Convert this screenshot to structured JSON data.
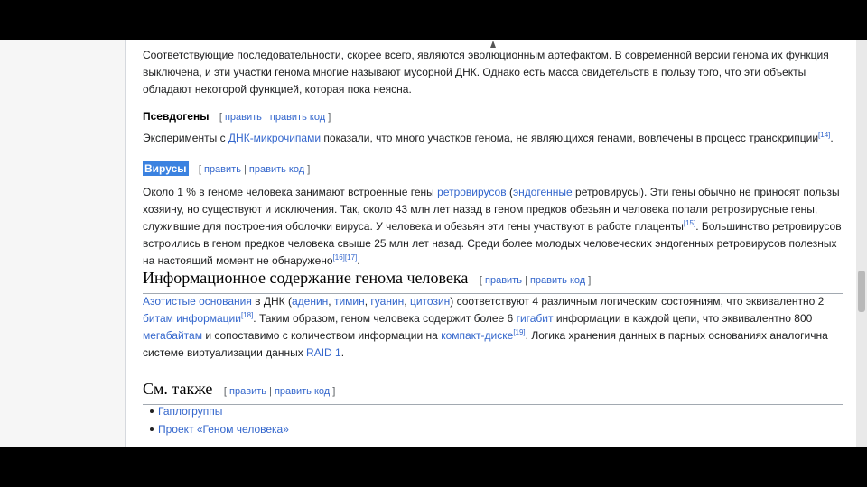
{
  "intro_text": "Соответствующие последовательности, скорее всего, являются эволюционным артефактом. В современной версии генома их функция выключена, и эти участки генома многие называют мусорной ДНК. Однако есть масса свидетельств в пользу того, что эти объекты обладают некоторой функцией, которая пока неясна.",
  "edit": {
    "open": "[",
    "edit": "править",
    "sep": "|",
    "edit_code": "править код",
    "close": "]"
  },
  "pseudogenes": {
    "heading": "Псевдогены",
    "p_before": "Эксперименты с ",
    "link_dna_chips": "ДНК-микрочипами",
    "p_after": " показали, что много участков генома, не являющихся генами, вовлечены в процесс транскрипции",
    "ref": "[14]",
    "end": "."
  },
  "viruses": {
    "heading": "Вирусы",
    "t1": "Около 1 % в геноме человека занимают встроенные гены ",
    "link_retro": "ретровирусов",
    "t2": " (",
    "link_endo": "эндогенные",
    "t3": " ретровирусы). Эти гены обычно не приносят пользы хозяину, но существуют и исключения. Так, около 43 млн лет назад в геном предков обезьян и человека попали ретровирусные гены, служившие для построения оболочки вируса. У человека и обезьян эти гены участвуют в работе плаценты",
    "ref15": "[15]",
    "t4": ". Большинство ретровирусов встроились в геном предков человека свыше 25 млн лет назад. Среди более молодых человеческих эндогенных ретровирусов полезных на настоящий момент не обнаружено",
    "ref16": "[16]",
    "ref17": "[17]",
    "end": "."
  },
  "info": {
    "heading": "Информационное содержание генома человека",
    "link_bases": "Азотистые основания",
    "t1": " в ДНК (",
    "link_adenine": "аденин",
    "c1": ", ",
    "link_thymine": "тимин",
    "c2": ", ",
    "link_guanine": "гуанин",
    "c3": ", ",
    "link_cytosine": "цитозин",
    "t2": ") соответствуют 4 различным логическим состояниям, что эквивалентно 2 ",
    "link_bits": "битам информации",
    "ref18": "[18]",
    "t3": ". Таким образом, геном человека содержит более 6 ",
    "link_gigabit": "гигабит",
    "t4": " информации в каждой цепи, что эквивалентно 800 ",
    "link_megabytes": "мегабайтам",
    "t5": " и сопоставимо с количеством информации на ",
    "link_cd": "компакт-диске",
    "ref19": "[19]",
    "t6": ". Логика хранения данных в парных основаниях аналогична системе виртуализации данных ",
    "link_raid": "RAID 1",
    "end": "."
  },
  "see_also": {
    "heading": "См. также",
    "items": [
      "Гаплогруппы",
      "Проект «Геном человека»"
    ]
  }
}
